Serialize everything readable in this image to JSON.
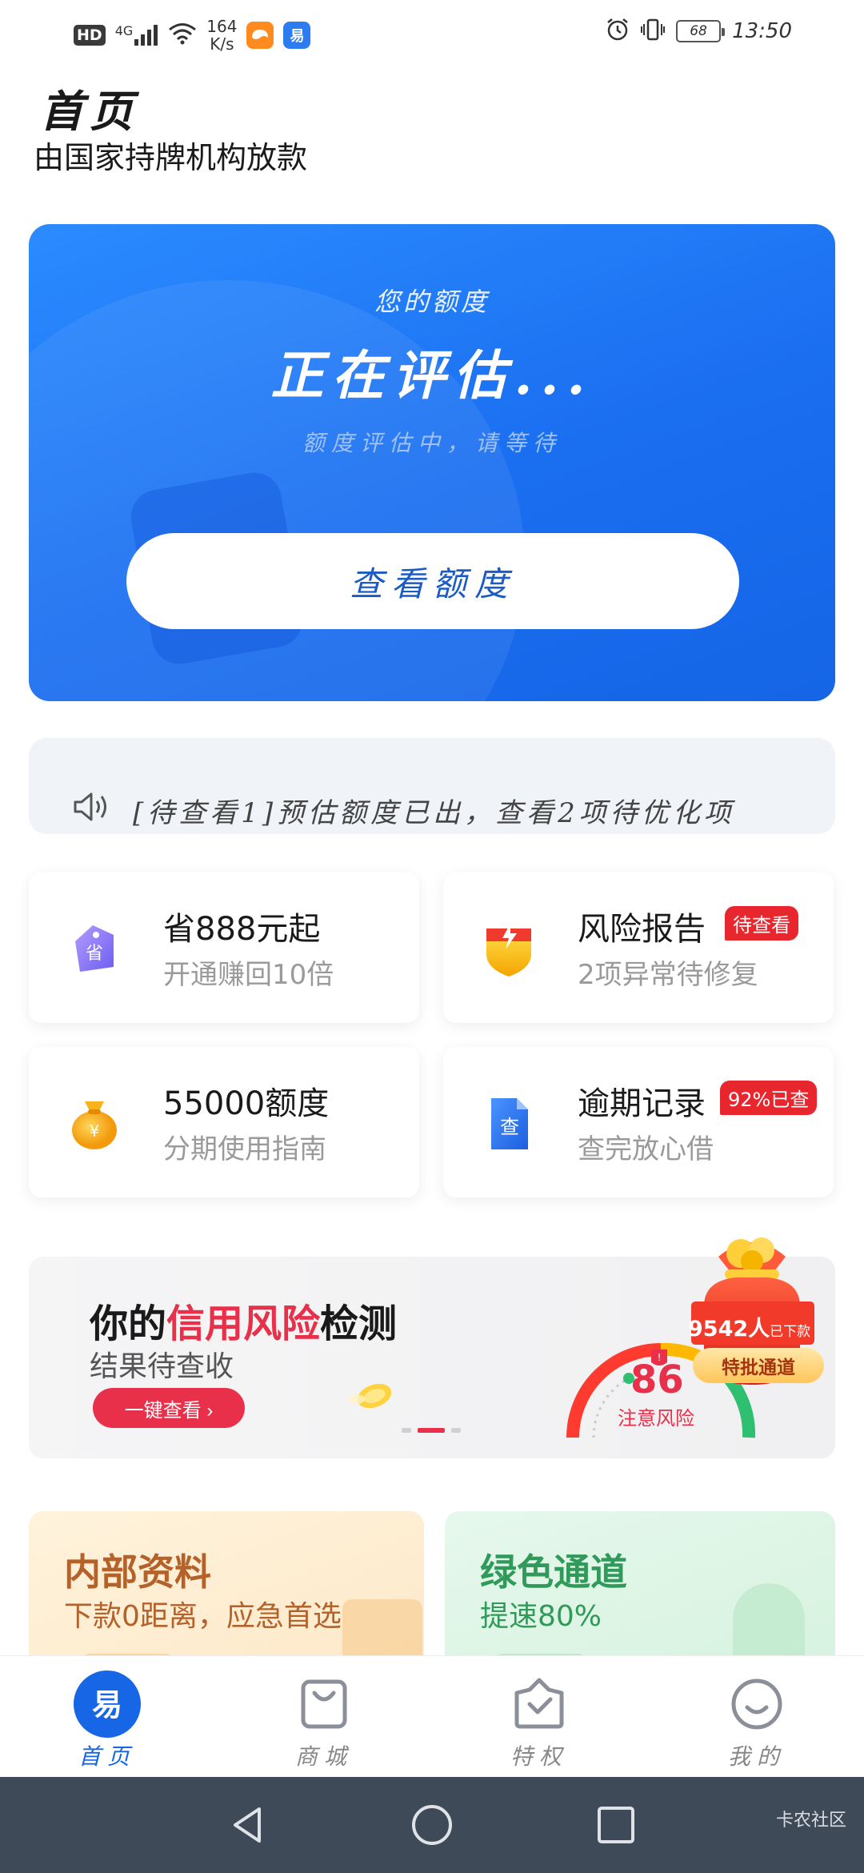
{
  "status_bar": {
    "hd": "HD",
    "network": "4G",
    "speed_value": "164",
    "speed_unit": "K/s",
    "battery": "68",
    "time": "13:50"
  },
  "header": {
    "title": "首页",
    "subtitle": "由国家持牌机构放款"
  },
  "quota_card": {
    "label": "您的额度",
    "status": "正在评估...",
    "hint": "额度评估中，请等待",
    "button_label": "查看额度"
  },
  "notice": {
    "text": "[待查看1]预估额度已出，查看2项待优化项"
  },
  "features": [
    {
      "title": "省888元起",
      "subtitle": "开通赚回10倍",
      "badge": "",
      "icon": "tag-icon",
      "icon_text": "省"
    },
    {
      "title": "风险报告",
      "subtitle": "2项异常待修复",
      "badge": "待查看",
      "icon": "shield-icon",
      "icon_text": ""
    },
    {
      "title": "55000额度",
      "subtitle": "分期使用指南",
      "badge": "",
      "icon": "money-bag-icon",
      "icon_text": "¥"
    },
    {
      "title": "逾期记录",
      "subtitle": "查完放心借",
      "badge": "92%已查",
      "icon": "document-icon",
      "icon_text": "查"
    }
  ],
  "credit_banner": {
    "title_prefix": "你的",
    "title_highlight": "信用风险",
    "title_suffix": "检测",
    "subtitle": "结果待查收",
    "button_label": "一键查看 ›",
    "score": "86",
    "risk_label": "注意风险"
  },
  "floating_badge": {
    "count": "9542人",
    "count_suffix": "已下款",
    "button_label": "特批通道"
  },
  "promos": [
    {
      "title": "内部资料",
      "subtitle": "下款0距离，应急首选"
    },
    {
      "title": "绿色通道",
      "subtitle": "提速80%"
    }
  ],
  "tabs": [
    {
      "label": "首页",
      "icon": "home-logo-icon",
      "active": true
    },
    {
      "label": "商城",
      "icon": "shopping-bag-icon",
      "active": false
    },
    {
      "label": "特权",
      "icon": "privilege-icon",
      "active": false
    },
    {
      "label": "我的",
      "icon": "profile-smile-icon",
      "active": false
    }
  ],
  "watermark": "卡农社区",
  "colors": {
    "primary_blue": "#1a6ef0",
    "accent_red": "#e8304a",
    "badge_red": "#e8262d",
    "promo_orange_text": "#b5612a",
    "promo_green_text": "#2f9a5a"
  }
}
